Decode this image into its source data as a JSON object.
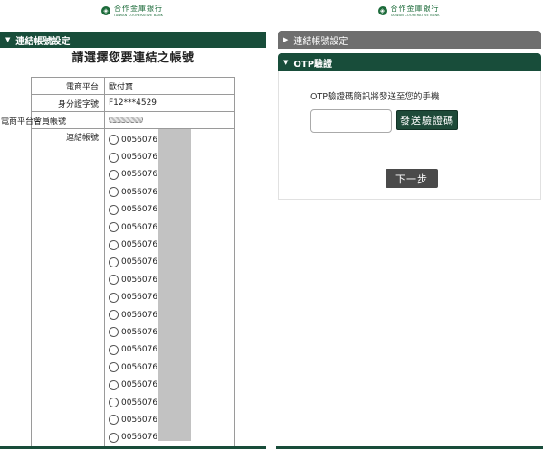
{
  "left_panel": {
    "logo": {
      "text": "合作金庫銀行",
      "sub": "TAIWAN COOPERATIVE BANK"
    },
    "section_title": "連結帳號設定",
    "page_title": "請選擇您要連結之帳號",
    "fields": [
      {
        "label": "電商平台",
        "value": "歐付寶"
      },
      {
        "label": "身分證字號",
        "value": "F12***4529"
      },
      {
        "label": "電商平台會員帳號",
        "value": ""
      }
    ],
    "accounts_label": "連結帳號",
    "accounts": [
      "0056076",
      "0056076",
      "0056076",
      "0056076",
      "0056076",
      "0056076",
      "0056076",
      "0056076",
      "0056076",
      "0056076",
      "0056076",
      "0056076",
      "0056076",
      "0056076",
      "0056076",
      "0056076",
      "0056076",
      "0056076"
    ]
  },
  "right_panel": {
    "logo": {
      "text": "合作金庫銀行",
      "sub": "TAIWAN COOPERATIVE BANK"
    },
    "collapsed_section": "連結帳號設定",
    "otp_section": "OTP驗證",
    "otp_message": "OTP驗證碼簡訊將發送至您的手機",
    "otp_input_value": "",
    "send_button": "發送驗證碼",
    "next_button": "下一步"
  },
  "colors": {
    "brand_green": "#184d3a",
    "gray_header": "#6e6e6e",
    "mask_gray": "#c2c2c2"
  }
}
